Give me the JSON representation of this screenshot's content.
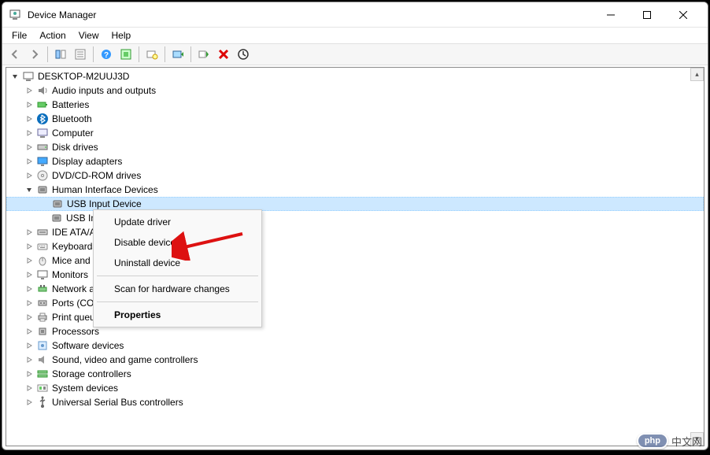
{
  "window": {
    "title": "Device Manager"
  },
  "menubar": {
    "items": [
      "File",
      "Action",
      "View",
      "Help"
    ]
  },
  "tree": {
    "root": {
      "label": "DESKTOP-M2UUJ3D",
      "expanded": true
    },
    "categories": [
      {
        "label": "Audio inputs and outputs",
        "icon": "audio-icon",
        "expanded": false
      },
      {
        "label": "Batteries",
        "icon": "battery-icon",
        "expanded": false
      },
      {
        "label": "Bluetooth",
        "icon": "bluetooth-icon",
        "expanded": false
      },
      {
        "label": "Computer",
        "icon": "computer-icon",
        "expanded": false
      },
      {
        "label": "Disk drives",
        "icon": "disk-icon",
        "expanded": false
      },
      {
        "label": "Display adapters",
        "icon": "display-icon",
        "expanded": false
      },
      {
        "label": "DVD/CD-ROM drives",
        "icon": "dvd-icon",
        "expanded": false
      },
      {
        "label": "Human Interface Devices",
        "icon": "hid-icon",
        "expanded": true,
        "children": [
          {
            "label": "USB Input Device",
            "icon": "hid-icon",
            "selected": true
          },
          {
            "label": "USB Input Device",
            "icon": "hid-icon",
            "selected": false
          }
        ]
      },
      {
        "label": "IDE ATA/ATAPI controllers",
        "icon": "ide-icon",
        "expanded": false
      },
      {
        "label": "Keyboards",
        "icon": "keyboard-icon",
        "expanded": false
      },
      {
        "label": "Mice and other pointing devices",
        "icon": "mouse-icon",
        "expanded": false
      },
      {
        "label": "Monitors",
        "icon": "monitor-icon",
        "expanded": false
      },
      {
        "label": "Network adapters",
        "icon": "network-icon",
        "expanded": false
      },
      {
        "label": "Ports (COM & LPT)",
        "icon": "port-icon",
        "expanded": false
      },
      {
        "label": "Print queues",
        "icon": "printer-icon",
        "expanded": false
      },
      {
        "label": "Processors",
        "icon": "cpu-icon",
        "expanded": false
      },
      {
        "label": "Software devices",
        "icon": "software-icon",
        "expanded": false
      },
      {
        "label": "Sound, video and game controllers",
        "icon": "sound-icon",
        "expanded": false
      },
      {
        "label": "Storage controllers",
        "icon": "storage-icon",
        "expanded": false
      },
      {
        "label": "System devices",
        "icon": "system-icon",
        "expanded": false
      },
      {
        "label": "Universal Serial Bus controllers",
        "icon": "usb-icon",
        "expanded": false
      }
    ]
  },
  "context_menu": {
    "items": [
      {
        "label": "Update driver",
        "type": "item"
      },
      {
        "label": "Disable device",
        "type": "item"
      },
      {
        "label": "Uninstall device",
        "type": "item"
      },
      {
        "type": "sep"
      },
      {
        "label": "Scan for hardware changes",
        "type": "item"
      },
      {
        "type": "sep"
      },
      {
        "label": "Properties",
        "type": "item",
        "bold": true
      }
    ]
  },
  "watermark": {
    "badge": "php",
    "text": "中文网"
  }
}
